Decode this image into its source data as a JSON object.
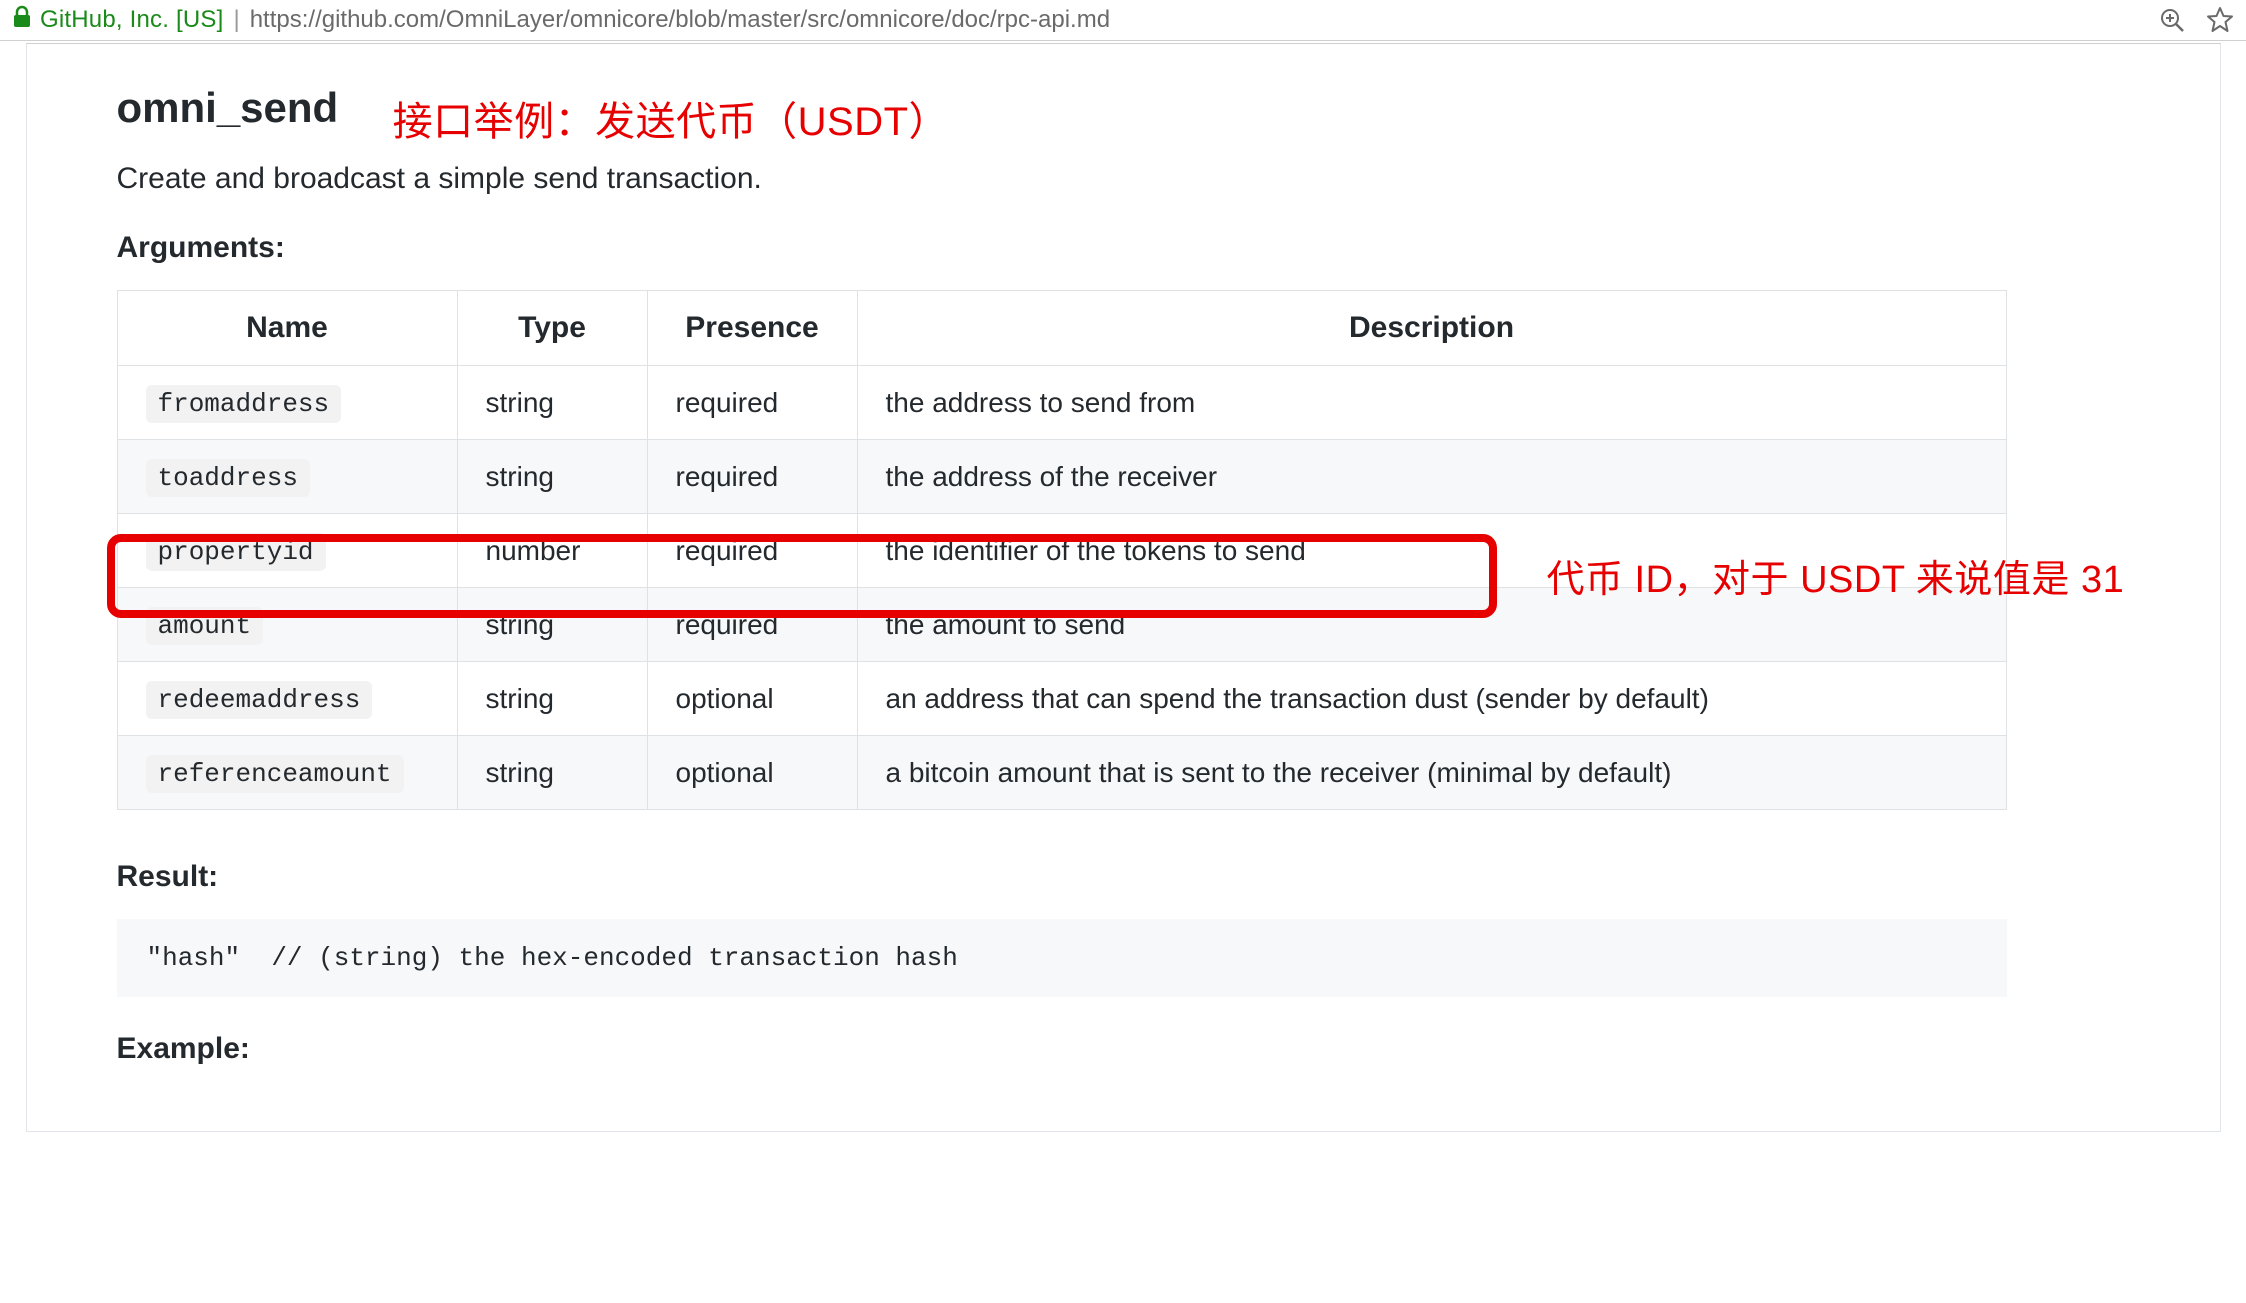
{
  "browser": {
    "secure_label": "GitHub, Inc. [US]",
    "url": "https://github.com/OmniLayer/omnicore/blob/master/src/omnicore/doc/rpc-api.md"
  },
  "doc": {
    "heading": "omni_send",
    "annotation_heading": "接口举例：发送代币（USDT）",
    "intro": "Create and broadcast a simple send transaction.",
    "arguments_heading": "Arguments:",
    "table": {
      "headers": [
        "Name",
        "Type",
        "Presence",
        "Description"
      ],
      "rows": [
        {
          "name": "fromaddress",
          "type": "string",
          "presence": "required",
          "description": "the address to send from"
        },
        {
          "name": "toaddress",
          "type": "string",
          "presence": "required",
          "description": "the address of the receiver"
        },
        {
          "name": "propertyid",
          "type": "number",
          "presence": "required",
          "description": "the identifier of the tokens to send"
        },
        {
          "name": "amount",
          "type": "string",
          "presence": "required",
          "description": "the amount to send"
        },
        {
          "name": "redeemaddress",
          "type": "string",
          "presence": "optional",
          "description": "an address that can spend the transaction dust (sender by default)"
        },
        {
          "name": "referenceamount",
          "type": "string",
          "presence": "optional",
          "description": "a bitcoin amount that is sent to the receiver (minimal by default)"
        }
      ]
    },
    "annotation_side": "代币 ID，对于 USDT 来说值是 31",
    "result_heading": "Result:",
    "result_code": "\"hash\"  // (string) the hex-encoded transaction hash",
    "example_heading": "Example:"
  }
}
